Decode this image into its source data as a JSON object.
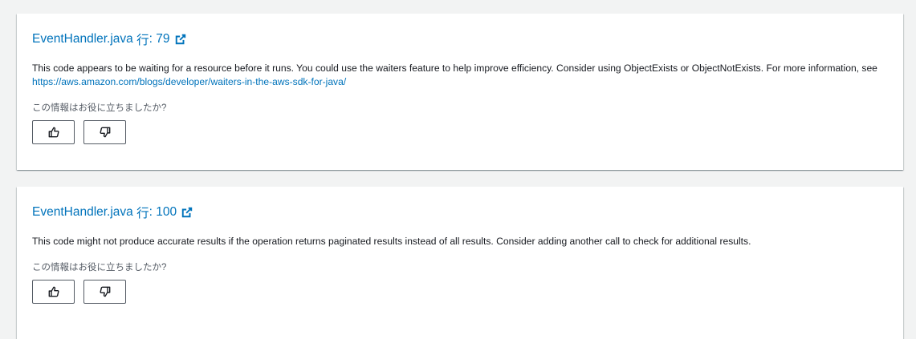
{
  "findings": [
    {
      "file_name": "EventHandler.java",
      "line_label": "行",
      "line_number": "79",
      "description_text": "This code appears to be waiting for a resource before it runs. You could use the waiters feature to help improve efficiency. Consider using ObjectExists or ObjectNotExists. For more information, see ",
      "link_text": "https://aws.amazon.com/blogs/developer/waiters-in-the-aws-sdk-for-java/",
      "feedback_question": "この情報はお役に立ちましたか?",
      "external_icon": "external-link-icon",
      "helpful_icon": "thumbs-up-icon",
      "unhelpful_icon": "thumbs-down-icon"
    },
    {
      "file_name": "EventHandler.java",
      "line_label": "行",
      "line_number": "100",
      "description_text": "This code might not produce accurate results if the operation returns paginated results instead of all results. Consider adding another call to check for additional results.",
      "feedback_question": "この情報はお役に立ちましたか?",
      "external_icon": "external-link-icon",
      "helpful_icon": "thumbs-up-icon",
      "unhelpful_icon": "thumbs-down-icon"
    }
  ],
  "colors": {
    "link": "#0073bb",
    "text": "#16191f",
    "muted": "#545b64",
    "page_background": "#f2f3f3",
    "card_background": "#ffffff"
  }
}
